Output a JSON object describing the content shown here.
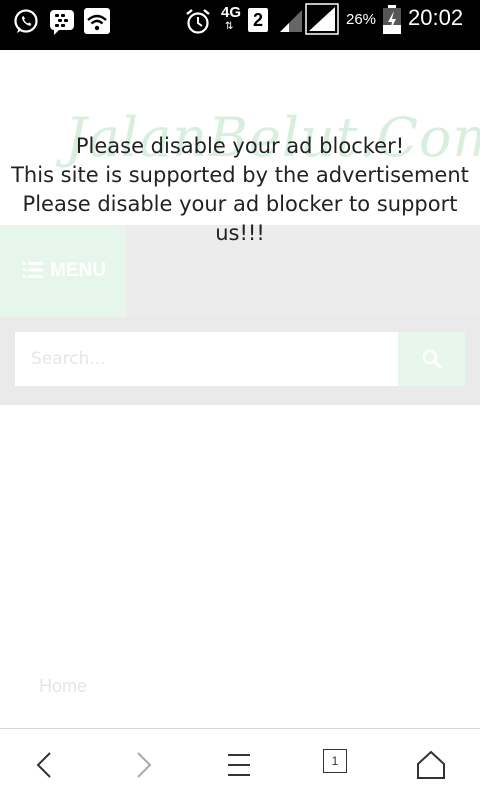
{
  "status_bar": {
    "network_type": "4G",
    "sim_slot": "2",
    "battery_percent": "26%",
    "time": "20:02",
    "icons": [
      "whatsapp-icon",
      "blackberry-messenger-icon",
      "wifi-icon",
      "alarm-icon",
      "signal-icon",
      "battery-charging-icon"
    ]
  },
  "site": {
    "logo_text": "JalanBelut.Com",
    "menu_label": "MENU",
    "search": {
      "placeholder": "Search..."
    },
    "home_link": "Home",
    "accent_color": "#e8f7eb"
  },
  "adblock_notice": {
    "line1": "Please disable your ad blocker!",
    "line2": "This site is supported by the advertisement",
    "line3": "Please disable your ad blocker to support",
    "line4": "us!!!"
  },
  "browser_toolbar": {
    "tab_count": "1",
    "buttons": [
      "back-icon",
      "forward-icon",
      "menu-icon",
      "tabs-icon",
      "home-icon"
    ]
  }
}
